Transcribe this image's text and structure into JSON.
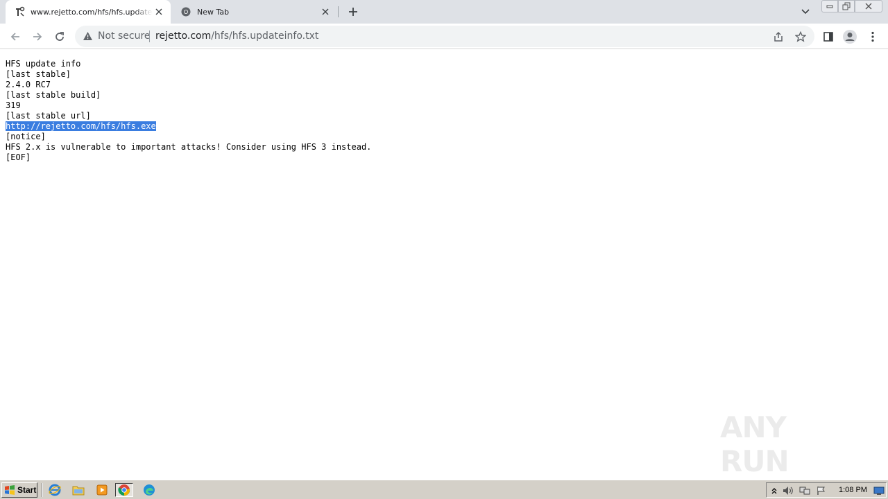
{
  "browser": {
    "tabs": [
      {
        "title": "www.rejetto.com/hfs/hfs.updateinfo.txt",
        "active": true,
        "favicon": "rejetto-favicon-icon"
      },
      {
        "title": "New Tab",
        "active": false,
        "favicon": "chrome-icon"
      }
    ],
    "omnibox": {
      "security_label": "Not secure",
      "url_host": "rejetto.com",
      "url_path": "/hfs/hfs.updateinfo.txt"
    }
  },
  "document": {
    "lines": [
      "HFS update info",
      "[last stable]",
      "2.4.0 RC7",
      "[last stable build]",
      "319",
      "[last stable url]",
      "http://rejetto.com/hfs/hfs.exe",
      "[notice]",
      "HFS 2.x is vulnerable to important attacks! Consider using HFS 3 instead.",
      "[EOF]"
    ],
    "selected_line_index": 6
  },
  "watermark": {
    "text": "ANY RUN"
  },
  "taskbar": {
    "start_label": "Start",
    "clock": "1:08 PM",
    "quick_launch": [
      "internet-explorer-icon",
      "folder-icon",
      "media-player-icon",
      "chrome-icon",
      "edge-icon"
    ]
  },
  "colors": {
    "selection": "#3a7de0",
    "tabstrip": "#dee1e6",
    "omnibox": "#f1f3f4",
    "taskbar": "#d4d0c8"
  }
}
